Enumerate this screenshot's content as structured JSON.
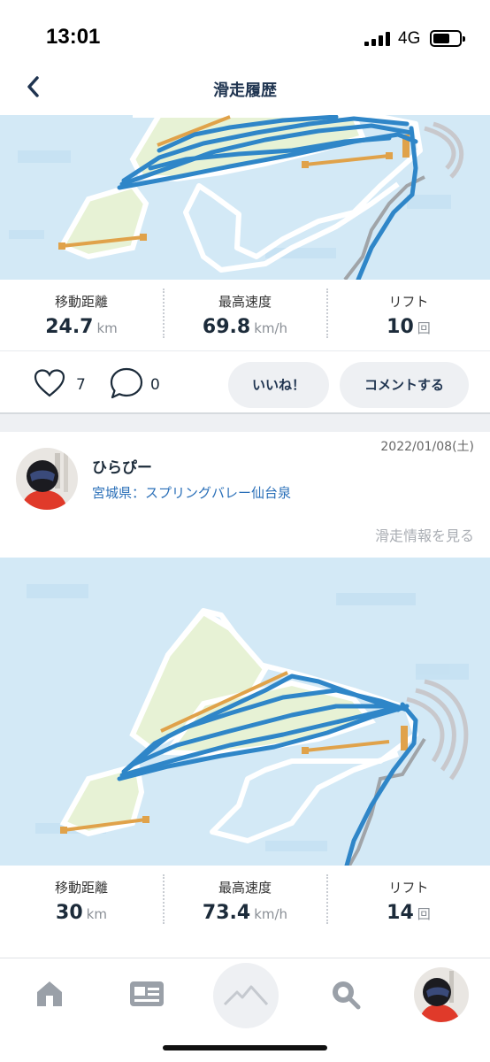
{
  "status_bar": {
    "time": "13:01",
    "network": "4G"
  },
  "nav": {
    "title": "滑走履歴"
  },
  "post1": {
    "stats": [
      {
        "label": "移動距離",
        "value": "24.7",
        "unit": "km"
      },
      {
        "label": "最高速度",
        "value": "69.8",
        "unit": "km/h"
      },
      {
        "label": "リフト",
        "value": "10",
        "unit": "回"
      }
    ],
    "likes": "7",
    "comments": "0",
    "like_button": "いいね！",
    "comment_button": "コメントする"
  },
  "post2": {
    "date": "2022/01/08(土)",
    "user_name": "ひらぴー",
    "location": "宮城県：スプリングバレー仙台泉",
    "detail_link": "滑走情報を見る",
    "stats": [
      {
        "label": "移動距離",
        "value": "30",
        "unit": "km"
      },
      {
        "label": "最高速度",
        "value": "73.4",
        "unit": "km/h"
      },
      {
        "label": "リフト",
        "value": "14",
        "unit": "回"
      }
    ]
  },
  "tab_bar": {
    "items": [
      {
        "icon": "home-icon"
      },
      {
        "icon": "card-icon"
      },
      {
        "icon": "mountain-icon"
      },
      {
        "icon": "search-icon"
      },
      {
        "icon": "profile-avatar"
      }
    ]
  },
  "colors": {
    "map_water": "#d3e9f6",
    "track": "#2f86c8",
    "lift": "#e0a24a",
    "trail_area": "#e7f2d5",
    "link": "#2a6fb8",
    "nav_title": "#1f3450"
  }
}
